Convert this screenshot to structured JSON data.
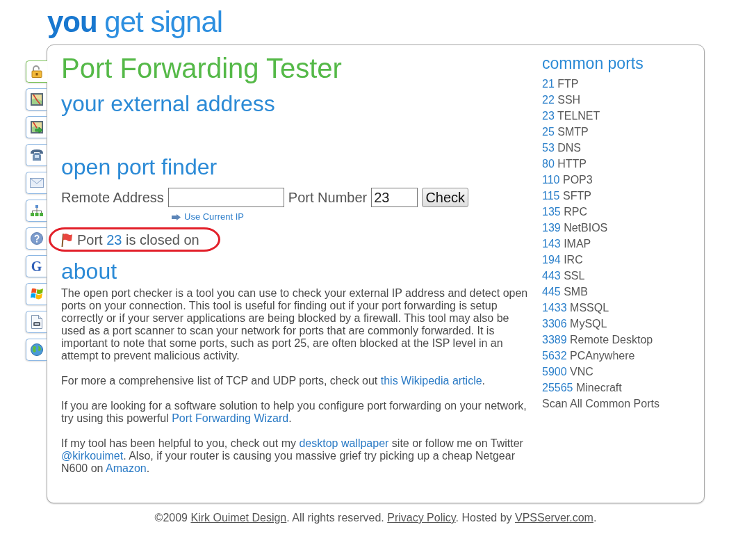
{
  "logo": {
    "emphasis": "you",
    "rest": "get signal"
  },
  "sidebar_tabs": [
    {
      "selected": true
    },
    {
      "selected": false
    },
    {
      "selected": false
    },
    {
      "selected": false
    },
    {
      "selected": false
    },
    {
      "selected": false
    },
    {
      "selected": false
    },
    {
      "selected": false,
      "glyph": "G"
    },
    {
      "selected": false
    },
    {
      "selected": false
    },
    {
      "selected": false
    }
  ],
  "title": "Port Forwarding Tester",
  "external_address": {
    "heading": "your external address"
  },
  "port_finder": {
    "heading": "open port finder",
    "remote_address": {
      "label": "Remote Address"
    },
    "port_number": {
      "label": "Port Number",
      "value": "23"
    },
    "check_button": "Check",
    "use_current_ip": "Use Current IP",
    "result": {
      "open": false,
      "highlighted": true,
      "text_before": "Port",
      "port": "23",
      "text_after": "is closed on"
    }
  },
  "about": {
    "heading": "about",
    "paragraphs": [
      {
        "segments": [
          {
            "kind": "text",
            "text": "The open port checker is a tool you can use to check your external IP address and detect open ports on your connection. This tool is useful for finding out if your port forwarding is setup correctly or if your server applications are being blocked by a firewall. This tool may also be used as a port scanner to scan your network for ports that are commonly forwarded. It is important to note that some ports, such as port 25, are often blocked at the ISP level in an attempt to prevent malicious activity."
          }
        ]
      },
      {
        "segments": [
          {
            "kind": "text",
            "text": "For more a comprehensive list of TCP and UDP ports, check out "
          },
          {
            "kind": "link",
            "text": "this Wikipedia article"
          },
          {
            "kind": "text",
            "text": "."
          }
        ]
      },
      {
        "segments": [
          {
            "kind": "text",
            "text": "If you are looking for a software solution to help you configure port forwarding on your network, try using this powerful "
          },
          {
            "kind": "link",
            "text": "Port Forwarding Wizard"
          },
          {
            "kind": "text",
            "text": "."
          }
        ]
      },
      {
        "segments": [
          {
            "kind": "text",
            "text": "If my tool has been helpful to you, check out my "
          },
          {
            "kind": "link",
            "text": "desktop wallpaper"
          },
          {
            "kind": "text",
            "text": " site or follow me on Twitter "
          },
          {
            "kind": "link",
            "text": "@kirkouimet"
          },
          {
            "kind": "text",
            "text": ". Also, if your router is causing you massive grief try picking up a cheap Netgear N600 on "
          },
          {
            "kind": "link",
            "text": "Amazon"
          },
          {
            "kind": "text",
            "text": "."
          }
        ]
      }
    ]
  },
  "common_ports": {
    "heading": "common ports",
    "items": [
      {
        "port": "21",
        "name": "FTP"
      },
      {
        "port": "22",
        "name": "SSH"
      },
      {
        "port": "23",
        "name": "TELNET"
      },
      {
        "port": "25",
        "name": "SMTP"
      },
      {
        "port": "53",
        "name": "DNS"
      },
      {
        "port": "80",
        "name": "HTTP"
      },
      {
        "port": "110",
        "name": "POP3"
      },
      {
        "port": "115",
        "name": "SFTP"
      },
      {
        "port": "135",
        "name": "RPC"
      },
      {
        "port": "139",
        "name": "NetBIOS"
      },
      {
        "port": "143",
        "name": "IMAP"
      },
      {
        "port": "194",
        "name": "IRC"
      },
      {
        "port": "443",
        "name": "SSL"
      },
      {
        "port": "445",
        "name": "SMB"
      },
      {
        "port": "1433",
        "name": "MSSQL"
      },
      {
        "port": "3306",
        "name": "MySQL"
      },
      {
        "port": "3389",
        "name": "Remote Desktop"
      },
      {
        "port": "5632",
        "name": "PCAnywhere"
      },
      {
        "port": "5900",
        "name": "VNC"
      },
      {
        "port": "25565",
        "name": "Minecraft"
      }
    ],
    "scan_all": "Scan All Common Ports"
  },
  "footer": {
    "segments": [
      {
        "kind": "text",
        "text": "©2009 "
      },
      {
        "kind": "link",
        "text": "Kirk Ouimet Design"
      },
      {
        "kind": "text",
        "text": ". All rights reserved. "
      },
      {
        "kind": "link",
        "text": "Privacy Policy"
      },
      {
        "kind": "text",
        "text": ". Hosted by "
      },
      {
        "kind": "link",
        "text": "VPSServer.com"
      },
      {
        "kind": "text",
        "text": "."
      }
    ]
  }
}
